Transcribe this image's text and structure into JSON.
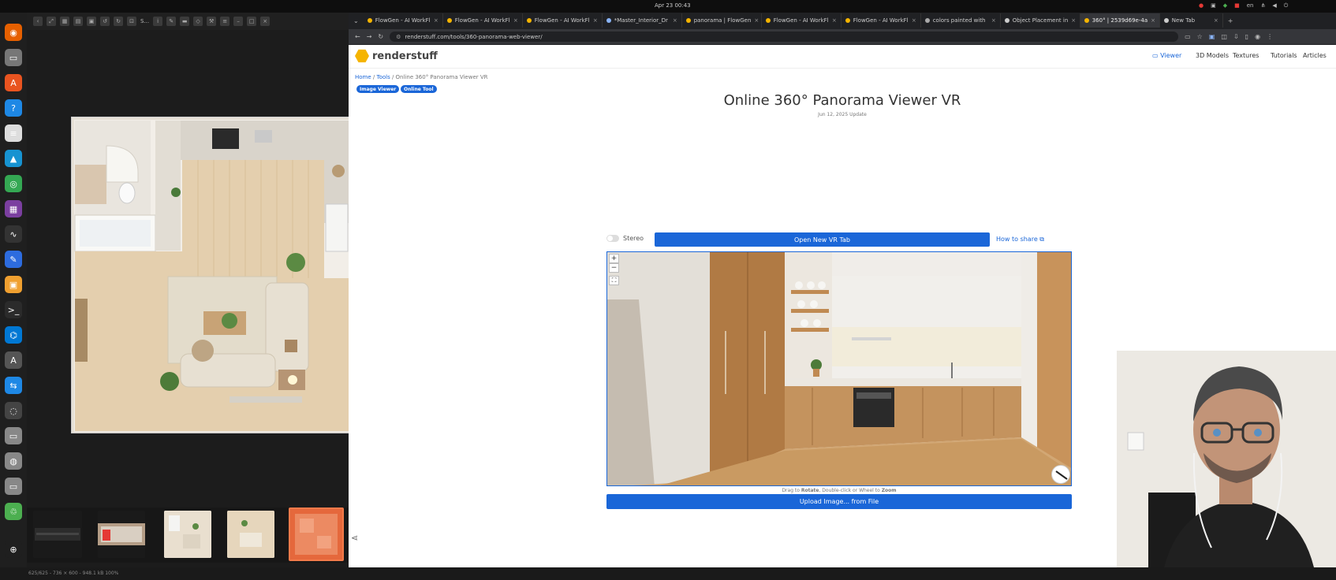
{
  "system": {
    "clock": "Apr 23  00:43",
    "lang": "en"
  },
  "dock": {
    "apps": [
      {
        "icon": "firefox-icon",
        "color": "#e66000"
      },
      {
        "icon": "files-icon",
        "color": "#777777"
      },
      {
        "icon": "app-center-icon",
        "color": "#e95420"
      },
      {
        "icon": "help-icon",
        "color": "#1e88e5"
      },
      {
        "icon": "document-icon",
        "color": "#dddddd"
      },
      {
        "icon": "arch-icon",
        "color": "#1793d1"
      },
      {
        "icon": "chrome-icon",
        "color": "#34a853"
      },
      {
        "icon": "workspace-icon",
        "color": "#7b3fa0"
      },
      {
        "icon": "monitor-icon",
        "color": "#333333"
      },
      {
        "icon": "notes-icon",
        "color": "#2d6cdf"
      },
      {
        "icon": "image-viewer-icon",
        "color": "#f0a030"
      },
      {
        "icon": "terminal-icon",
        "color": "#2b2b2b"
      },
      {
        "icon": "vscode-icon",
        "color": "#0078d4"
      },
      {
        "icon": "app-store-icon",
        "color": "#555555"
      },
      {
        "icon": "remote-desktop-icon",
        "color": "#1e88e5"
      },
      {
        "icon": "obs-icon",
        "color": "#444444"
      },
      {
        "icon": "drive-icon",
        "color": "#888888"
      },
      {
        "icon": "disk-icon",
        "color": "#888888"
      },
      {
        "icon": "drive2-icon",
        "color": "#888888"
      },
      {
        "icon": "trash-icon",
        "color": "#4caf50"
      }
    ]
  },
  "viewer": {
    "toolbar_label": "S...",
    "status": "625/625 - 736 × 600 - 948.1 kB     100%"
  },
  "browser": {
    "tabs": [
      {
        "label": "FlowGen - AI WorkFl",
        "color": "#f5b400"
      },
      {
        "label": "FlowGen - AI WorkFl",
        "color": "#f5b400"
      },
      {
        "label": "FlowGen - AI WorkFl",
        "color": "#f5b400"
      },
      {
        "label": "*Master_Interior_Dr",
        "color": "#8ab4f8"
      },
      {
        "label": "panorama | FlowGen",
        "color": "#f5b400"
      },
      {
        "label": "FlowGen - AI WorkFl",
        "color": "#f5b400"
      },
      {
        "label": "FlowGen - AI WorkFl",
        "color": "#f5b400"
      },
      {
        "label": "colors painted with",
        "color": "#aaaaaa"
      },
      {
        "label": "Object Placement in",
        "color": "#cccccc"
      },
      {
        "label": "360° | 2539d69e-4a",
        "color": "#f5b400",
        "active": true
      },
      {
        "label": "New Tab",
        "color": "#cccccc"
      }
    ],
    "url": "renderstuff.com/tools/360-panorama-web-viewer/"
  },
  "site": {
    "logo_prefix": "render",
    "logo_suffix": "stuff",
    "nav": {
      "viewer": "Viewer",
      "models": "3D Models",
      "textures": "Textures",
      "tutorials": "Tutorials",
      "articles": "Articles"
    },
    "breadcrumb": {
      "home": "Home",
      "tools": "Tools",
      "current": "Online 360° Panorama Viewer VR"
    },
    "badges": {
      "image_viewer": "Image Viewer",
      "online_tool": "Online Tool"
    },
    "title": "Online 360° Panorama Viewer VR",
    "date": "Jun 12, 2025 Update",
    "stereo_label": "Stereo",
    "vr_button": "Open New VR Tab",
    "share_link": "How to share",
    "zoom_in": "+",
    "zoom_out": "−",
    "hint_prefix": "Drag to ",
    "hint_rotate": "Rotate",
    "hint_mid": ", Double-click or Wheel to ",
    "hint_zoom": "Zoom",
    "upload_button": "Upload Image... from File"
  }
}
